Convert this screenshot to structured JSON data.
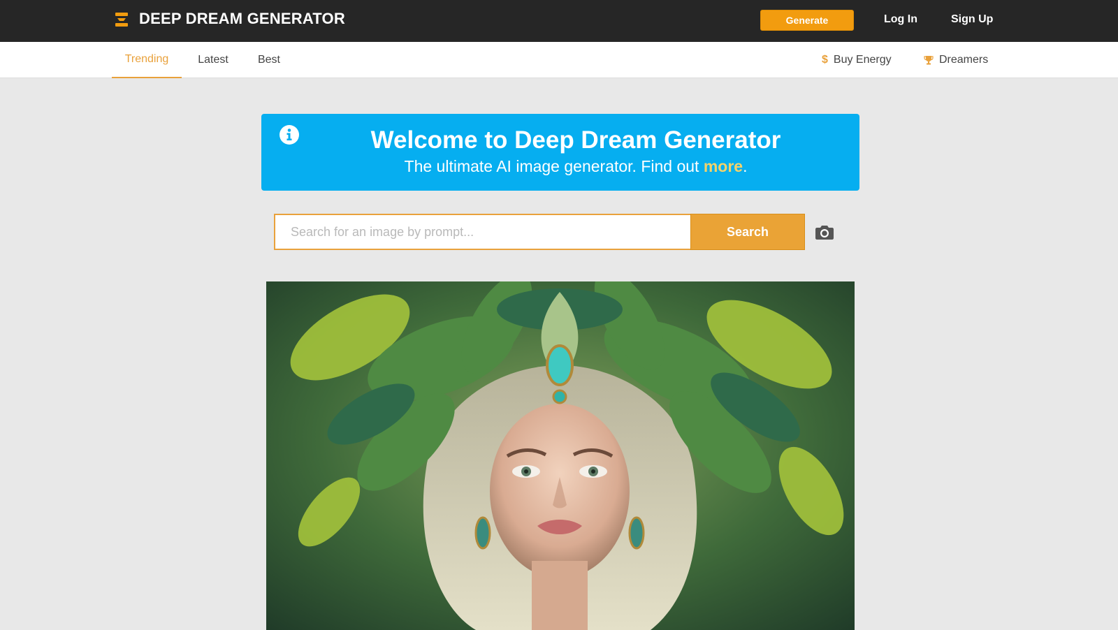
{
  "header": {
    "brand": "DEEP DREAM GENERATOR",
    "generate_label": "Generate",
    "login_label": "Log In",
    "signup_label": "Sign Up",
    "accent_color": "#f29c0f",
    "bar_color": "#262626"
  },
  "subnav": {
    "tabs": [
      {
        "label": "Trending",
        "active": true
      },
      {
        "label": "Latest",
        "active": false
      },
      {
        "label": "Best",
        "active": false
      }
    ],
    "buy_energy_icon": "$",
    "buy_energy_label": "Buy Energy",
    "dreamers_label": "Dreamers"
  },
  "banner": {
    "title": "Welcome to Deep Dream Generator",
    "subtitle_prefix": "The ultimate AI image generator. Find out ",
    "more_link": "more",
    "subtitle_suffix": ".",
    "background_color": "#06aef0"
  },
  "search": {
    "placeholder": "Search for an image by prompt...",
    "value": "",
    "button_label": "Search"
  },
  "icons": {
    "logo": "stacked-layers-icon",
    "info": "info-icon",
    "trophy": "trophy-icon",
    "camera": "camera-icon"
  }
}
